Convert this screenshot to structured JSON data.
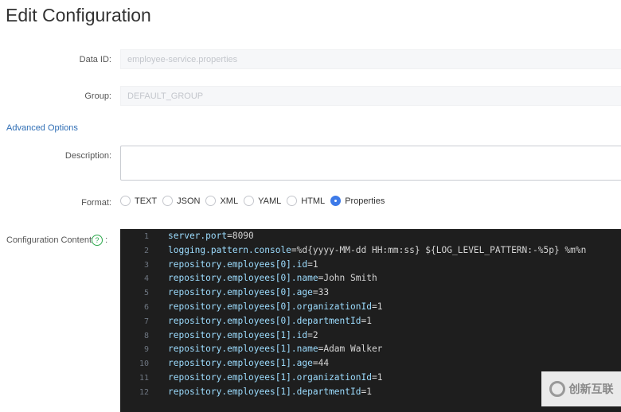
{
  "page_title": "Edit Configuration",
  "form": {
    "data_id_label": "Data ID:",
    "data_id_value": "employee-service.properties",
    "group_label": "Group:",
    "group_value": "DEFAULT_GROUP",
    "advanced_options": "Advanced Options",
    "description_label": "Description:",
    "description_value": "",
    "format_label": "Format:",
    "formats": [
      {
        "label": "TEXT",
        "selected": false
      },
      {
        "label": "JSON",
        "selected": false
      },
      {
        "label": "XML",
        "selected": false
      },
      {
        "label": "YAML",
        "selected": false
      },
      {
        "label": "HTML",
        "selected": false
      },
      {
        "label": "Properties",
        "selected": true
      }
    ],
    "content_label": "Configuration Content",
    "help_icon": "?",
    "content_colon": ":"
  },
  "editor": {
    "lines": [
      {
        "n": "1",
        "k": "server.port",
        "v": "=8090"
      },
      {
        "n": "2",
        "k": "logging.pattern.console",
        "v": "=%d{yyyy-MM-dd HH:mm:ss} ${LOG_LEVEL_PATTERN:-%5p} %m%n"
      },
      {
        "n": "3",
        "k": "repository.employees[0].id",
        "v": "=1"
      },
      {
        "n": "4",
        "k": "repository.employees[0].name",
        "v": "=John Smith"
      },
      {
        "n": "5",
        "k": "repository.employees[0].age",
        "v": "=33"
      },
      {
        "n": "6",
        "k": "repository.employees[0].organizationId",
        "v": "=1"
      },
      {
        "n": "7",
        "k": "repository.employees[0].departmentId",
        "v": "=1"
      },
      {
        "n": "8",
        "k": "repository.employees[1].id",
        "v": "=2"
      },
      {
        "n": "9",
        "k": "repository.employees[1].name",
        "v": "=Adam Walker"
      },
      {
        "n": "10",
        "k": "repository.employees[1].age",
        "v": "=44"
      },
      {
        "n": "11",
        "k": "repository.employees[1].organizationId",
        "v": "=1"
      },
      {
        "n": "12",
        "k": "repository.employees[1].departmentId",
        "v": "=1"
      }
    ]
  },
  "watermark": "创新互联",
  "colors": {
    "accent": "#3d7ae8",
    "link": "#2f6eb5",
    "editor_bg": "#1e1e1e",
    "key": "#9cdcfe"
  }
}
